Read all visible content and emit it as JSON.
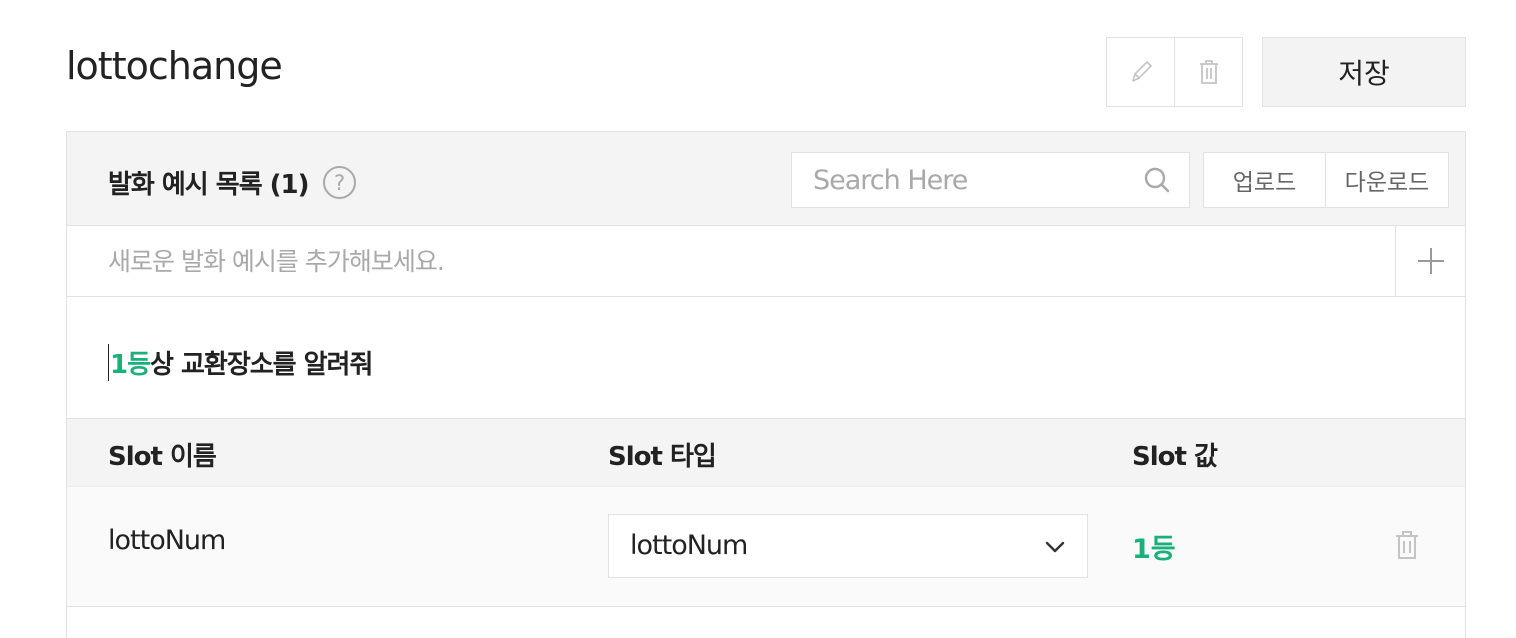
{
  "intent": {
    "title": "lottochange"
  },
  "toolbar": {
    "edit_icon": "pencil-icon",
    "delete_icon": "trash-icon",
    "save_label": "저장"
  },
  "utterances": {
    "list_title": "발화 예시 목록 (1)",
    "help_icon": "?",
    "search_placeholder": "Search Here",
    "upload_label": "업로드",
    "download_label": "다운로드",
    "add_placeholder": "새로운 발화 예시를 추가해보세요.",
    "items": [
      {
        "slot_part": "1등",
        "rest": "상 교환장소를 알려줘"
      }
    ]
  },
  "slots": {
    "columns": [
      "Slot 이름",
      "Slot 타입",
      "Slot 값"
    ],
    "rows": [
      {
        "name": "lottoNum",
        "type": "lottoNum",
        "value": "1등"
      }
    ]
  },
  "colors": {
    "accent": "#1ab07a",
    "border": "#e2e2e2",
    "header_bg": "#f4f4f4"
  }
}
